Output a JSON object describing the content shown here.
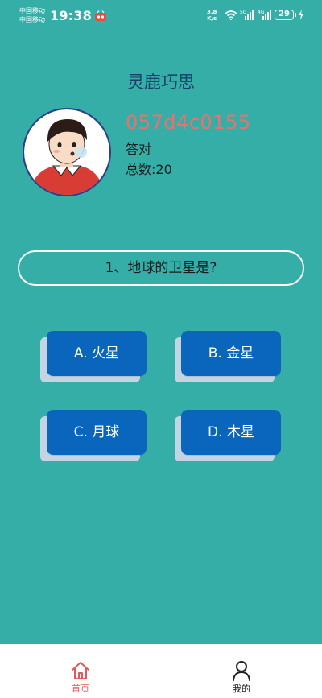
{
  "status_bar": {
    "carrier_1": "中国移动",
    "carrier_2": "中国移动",
    "time": "19:38",
    "net_speed_value": "3.8",
    "net_speed_unit": "K/s",
    "signal_1_label": "5G",
    "signal_2_label": "4G",
    "battery": "29"
  },
  "header": {
    "title": "灵鹿巧思"
  },
  "profile": {
    "user_id": "057d4c0155",
    "correct_label": "答对",
    "total_label": "总数:20"
  },
  "quiz": {
    "question": "1、地球的卫星是?",
    "options": [
      {
        "label": "A. 火星"
      },
      {
        "label": "B. 金星"
      },
      {
        "label": "C. 月球"
      },
      {
        "label": "D. 木星"
      }
    ]
  },
  "tabbar": {
    "items": [
      {
        "label": "首页",
        "icon": "home-icon",
        "active": true
      },
      {
        "label": "我的",
        "icon": "person-icon",
        "active": false
      }
    ]
  },
  "colors": {
    "background": "#35aea8",
    "title": "#173f6a",
    "user_id": "#ef6f6c",
    "option_button": "#0a66bd",
    "tab_active": "#e05a5a"
  }
}
